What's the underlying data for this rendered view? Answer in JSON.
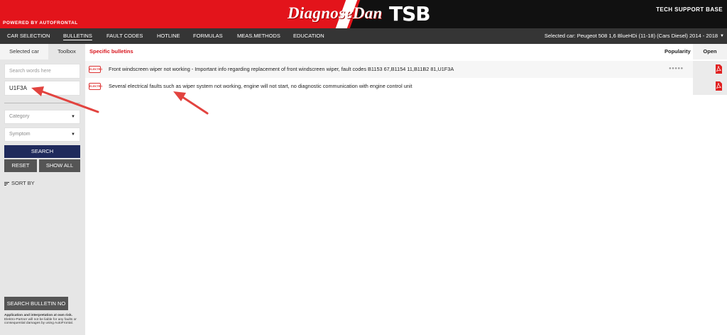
{
  "banner": {
    "powered_by": "POWERED BY AUTOFRONTAL",
    "logo_text": "DiagnoseDan",
    "logo_tsb": "TSB",
    "tagline": "TECH SUPPORT BASE"
  },
  "nav": {
    "items": [
      "CAR SELECTION",
      "BULLETINS",
      "FAULT CODES",
      "HOTLINE",
      "FORMULAS",
      "MEAS.METHODS",
      "EDUCATION"
    ],
    "active": "BULLETINS",
    "selected_car": "Selected car: Peugeot 508 1,6 BlueHDi (11-18) (Cars Diesel) 2014 - 2018"
  },
  "sidebar": {
    "tabs": [
      "Selected car",
      "Toolbox"
    ],
    "search_placeholder": "Search words here",
    "search_value": "U1F3A",
    "category_placeholder": "Category",
    "symptom_placeholder": "Symptom",
    "search_button": "SEARCH",
    "reset_button": "RESET",
    "show_all_button": "SHOW ALL",
    "sort_by": "SORT BY",
    "bulletin_no_button": "SEARCH BULLETIN NO",
    "disclaimer_bold": "Application and interpretation at own risk.",
    "disclaimer_text": "Elektro-Partner will not be liable for any faults or consequential damages by using AutoFrontal."
  },
  "main": {
    "section_title": "Specific bulletins",
    "col_popularity": "Popularity",
    "col_open": "Open",
    "rows": [
      {
        "badge": "ELEKTRO",
        "text": "Front windscreen wiper not working - Important info regarding replacement of front windscreen wiper, fault codes B1153 67,B1154 11,B11B2 81,U1F3A",
        "popularity": "●●●●●"
      },
      {
        "badge": "ELEKTRO",
        "text": "Several electrical faults such as wiper system not working, engine will not start, no diagnostic communication with engine control unit",
        "popularity": ""
      }
    ]
  },
  "colors": {
    "brand_red": "#e3141b",
    "nav_dark": "#353535",
    "search_button": "#1f2a5c",
    "grey_button": "#555555",
    "annotation_arrow": "#e2433f"
  }
}
